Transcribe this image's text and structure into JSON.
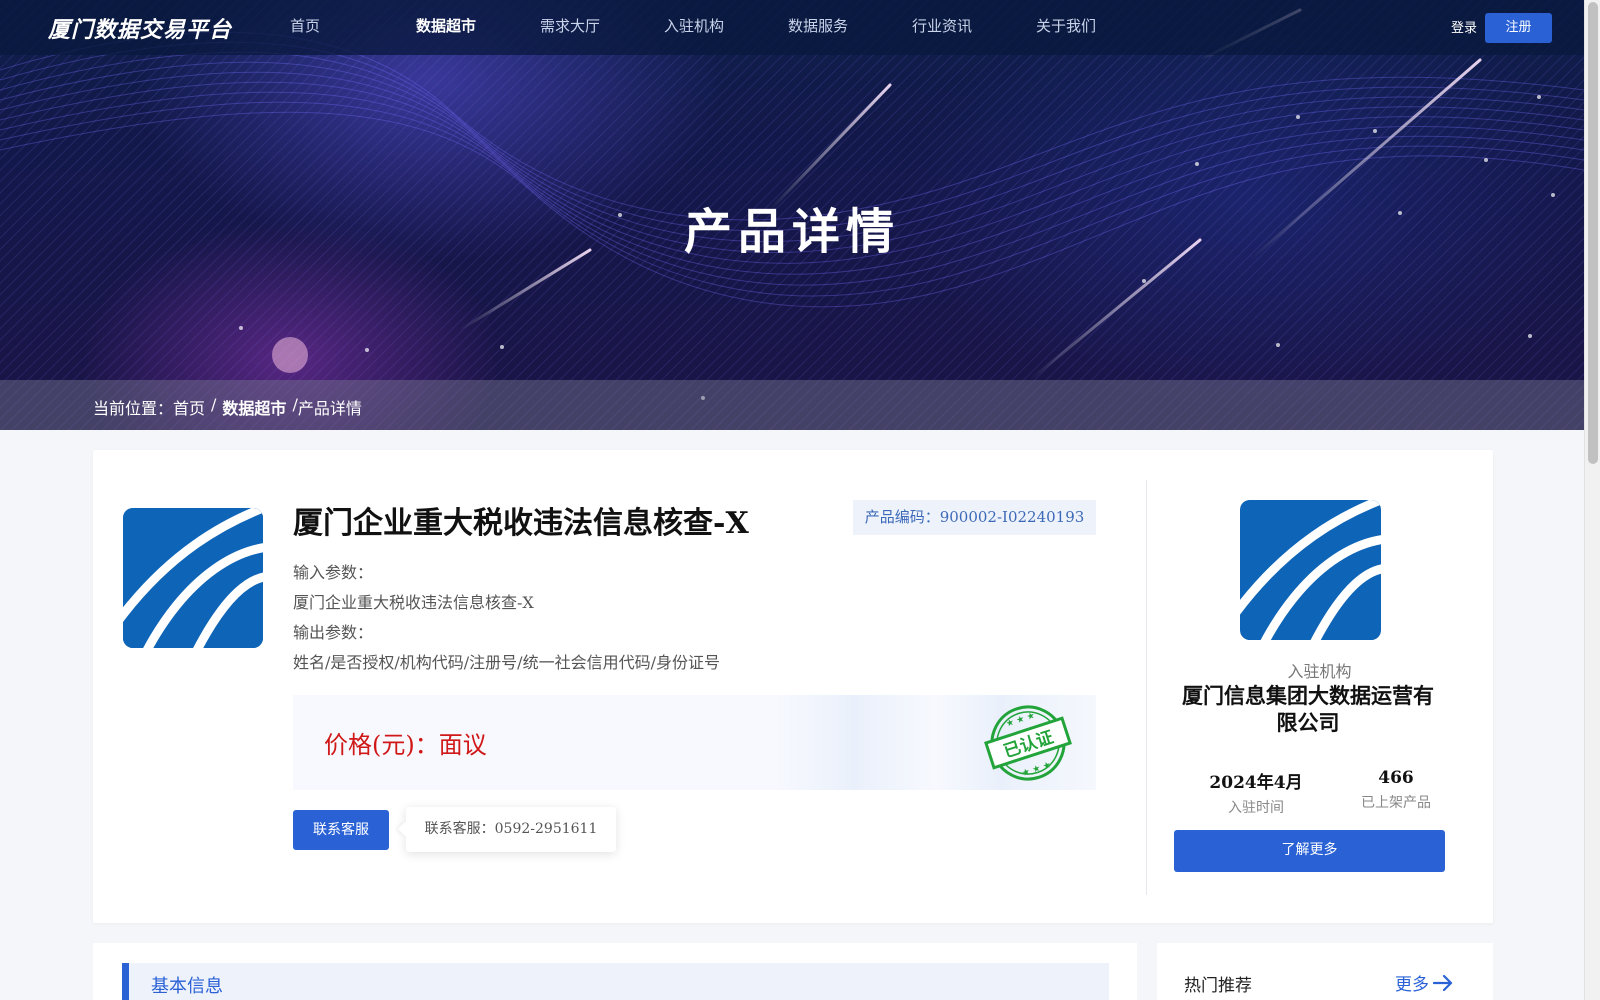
{
  "nav": {
    "logo": "厦门数据交易平台",
    "items": [
      {
        "label": "首页",
        "active": false
      },
      {
        "label": "数据超市",
        "active": true
      },
      {
        "label": "需求大厅",
        "active": false
      },
      {
        "label": "入驻机构",
        "active": false
      },
      {
        "label": "数据服务",
        "active": false
      },
      {
        "label": "行业资讯",
        "active": false
      },
      {
        "label": "关于我们",
        "active": false
      }
    ],
    "login": "登录",
    "register": "注册"
  },
  "hero": {
    "title": "产品详情"
  },
  "breadcrumb": {
    "prefix": "当前位置：",
    "home": "首页",
    "sep1": "/",
    "market": "数据超市",
    "sep2": "/",
    "current": "产品详情"
  },
  "product": {
    "title": "厦门企业重大税收违法信息核查-X",
    "code_label": "产品编码：",
    "code": "900002-I02240193",
    "input_label": "输入参数：",
    "input_value": "厦门企业重大税收违法信息核查-X",
    "output_label": "输出参数：",
    "output_value": "姓名/是否授权/机构代码/注册号/统一社会信用代码/身份证号",
    "price_label": "价格(元)：",
    "price_value": "面议",
    "stamp_text": "已认证",
    "contact_button": "联系客服",
    "contact_tip_label": "联系客服：",
    "contact_tip_phone": "0592-2951611"
  },
  "org": {
    "label": "入驻机构",
    "name": "厦门信息集团大数据运营有限公司",
    "join_time": "2024年4月",
    "join_time_label": "入驻时间",
    "products": "466",
    "products_label": "已上架产品",
    "learn_more": "了解更多"
  },
  "basic_info": {
    "title": "基本信息"
  },
  "hot": {
    "title": "热门推荐",
    "more": "更多"
  },
  "colors": {
    "accent": "#2a62d6",
    "price": "#d01818",
    "stamp": "#22a43a",
    "logo_blue": "#0e64b7"
  }
}
